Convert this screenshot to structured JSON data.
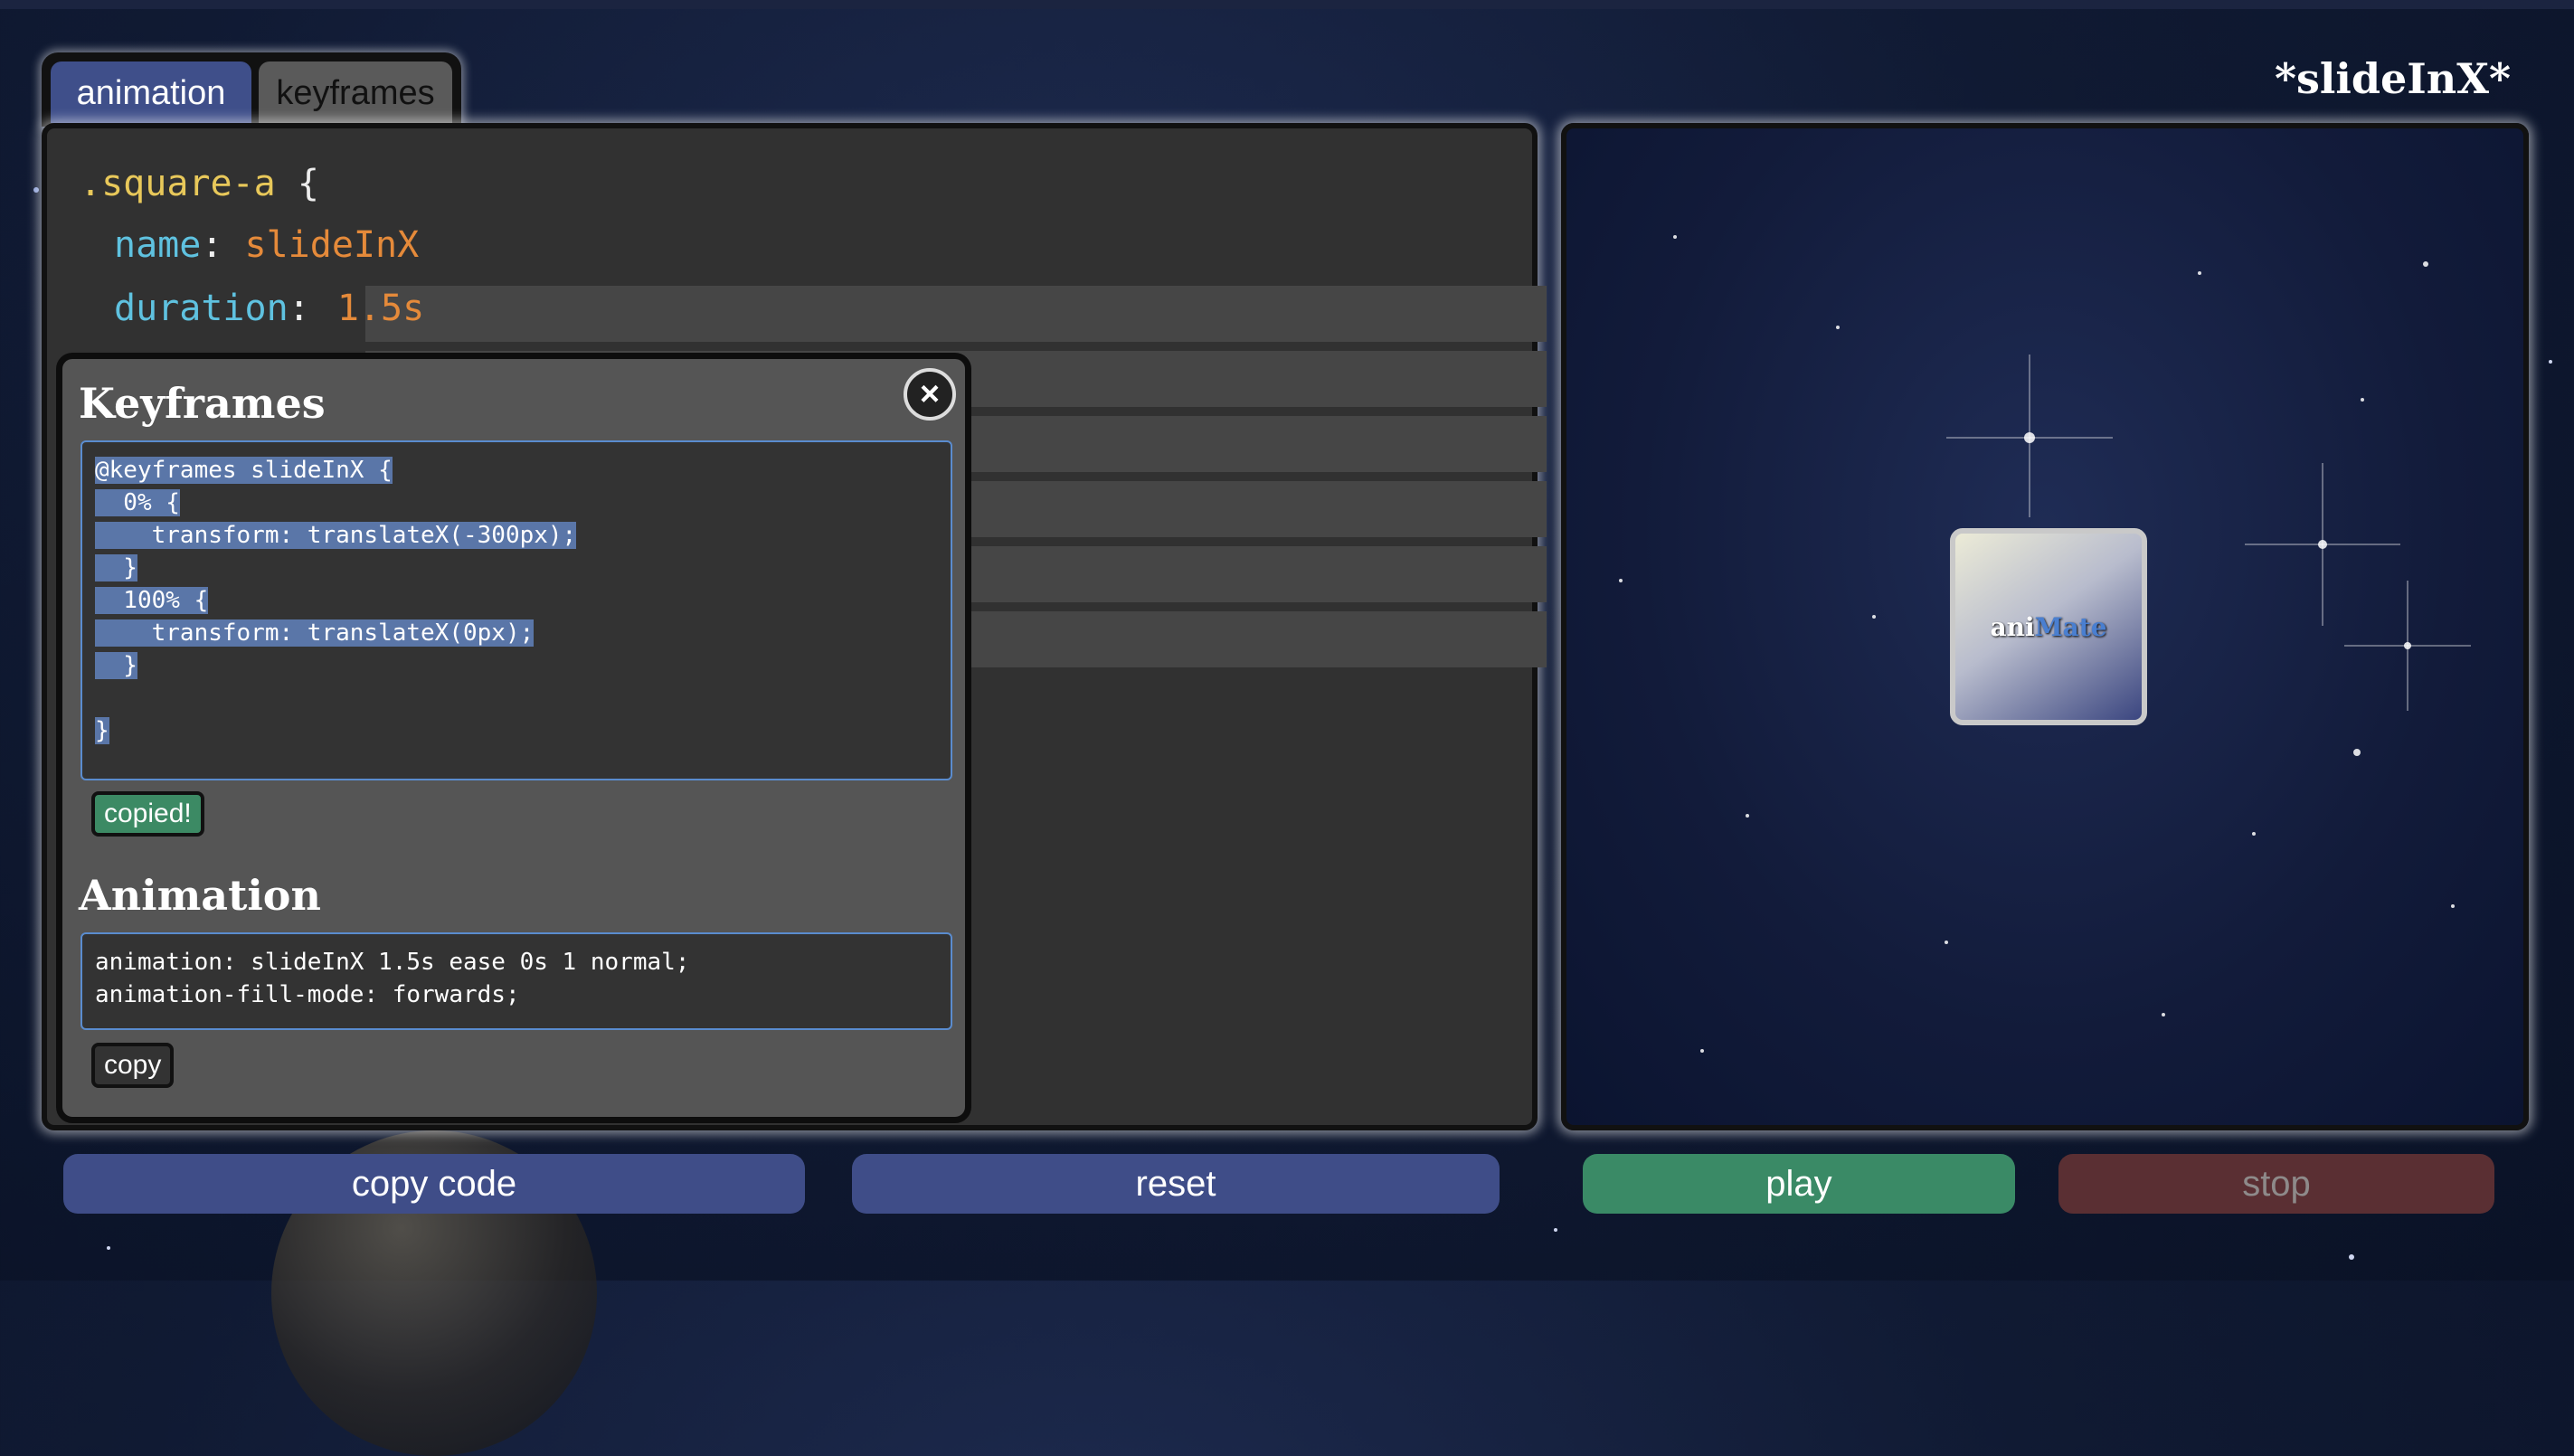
{
  "app": {
    "title": "*slideInX*"
  },
  "tabs": [
    {
      "label": "animation",
      "active": true
    },
    {
      "label": "keyframes",
      "active": false
    }
  ],
  "editor": {
    "selector": ".square-a",
    "open_brace": "{",
    "properties": [
      {
        "name": "name",
        "value": "slideInX"
      },
      {
        "name": "duration",
        "value": "1.5s"
      }
    ]
  },
  "modal": {
    "keyframes_title": "Keyframes",
    "keyframes_code": [
      "@keyframes slideInX {",
      "  0% {",
      "    transform: translateX(-300px);",
      "  }",
      "  100% {",
      "    transform: translateX(0px);",
      "  }",
      "",
      "}"
    ],
    "copied_label": "copied!",
    "animation_title": "Animation",
    "animation_code": [
      "animation: slideInX 1.5s ease 0s 1 normal;",
      "animation-fill-mode: forwards;"
    ],
    "copy_label": "copy",
    "close_symbol": "×"
  },
  "preview": {
    "logo_part1": "ani",
    "logo_part2": "Mate"
  },
  "buttons": {
    "copy_code": "copy code",
    "reset": "reset",
    "play": "play",
    "stop": "stop"
  },
  "colors": {
    "accent_blue": "#3f4d88",
    "play_green": "#3a8a66",
    "stop_red": "#5a2f33",
    "selection": "#5a76a8"
  }
}
